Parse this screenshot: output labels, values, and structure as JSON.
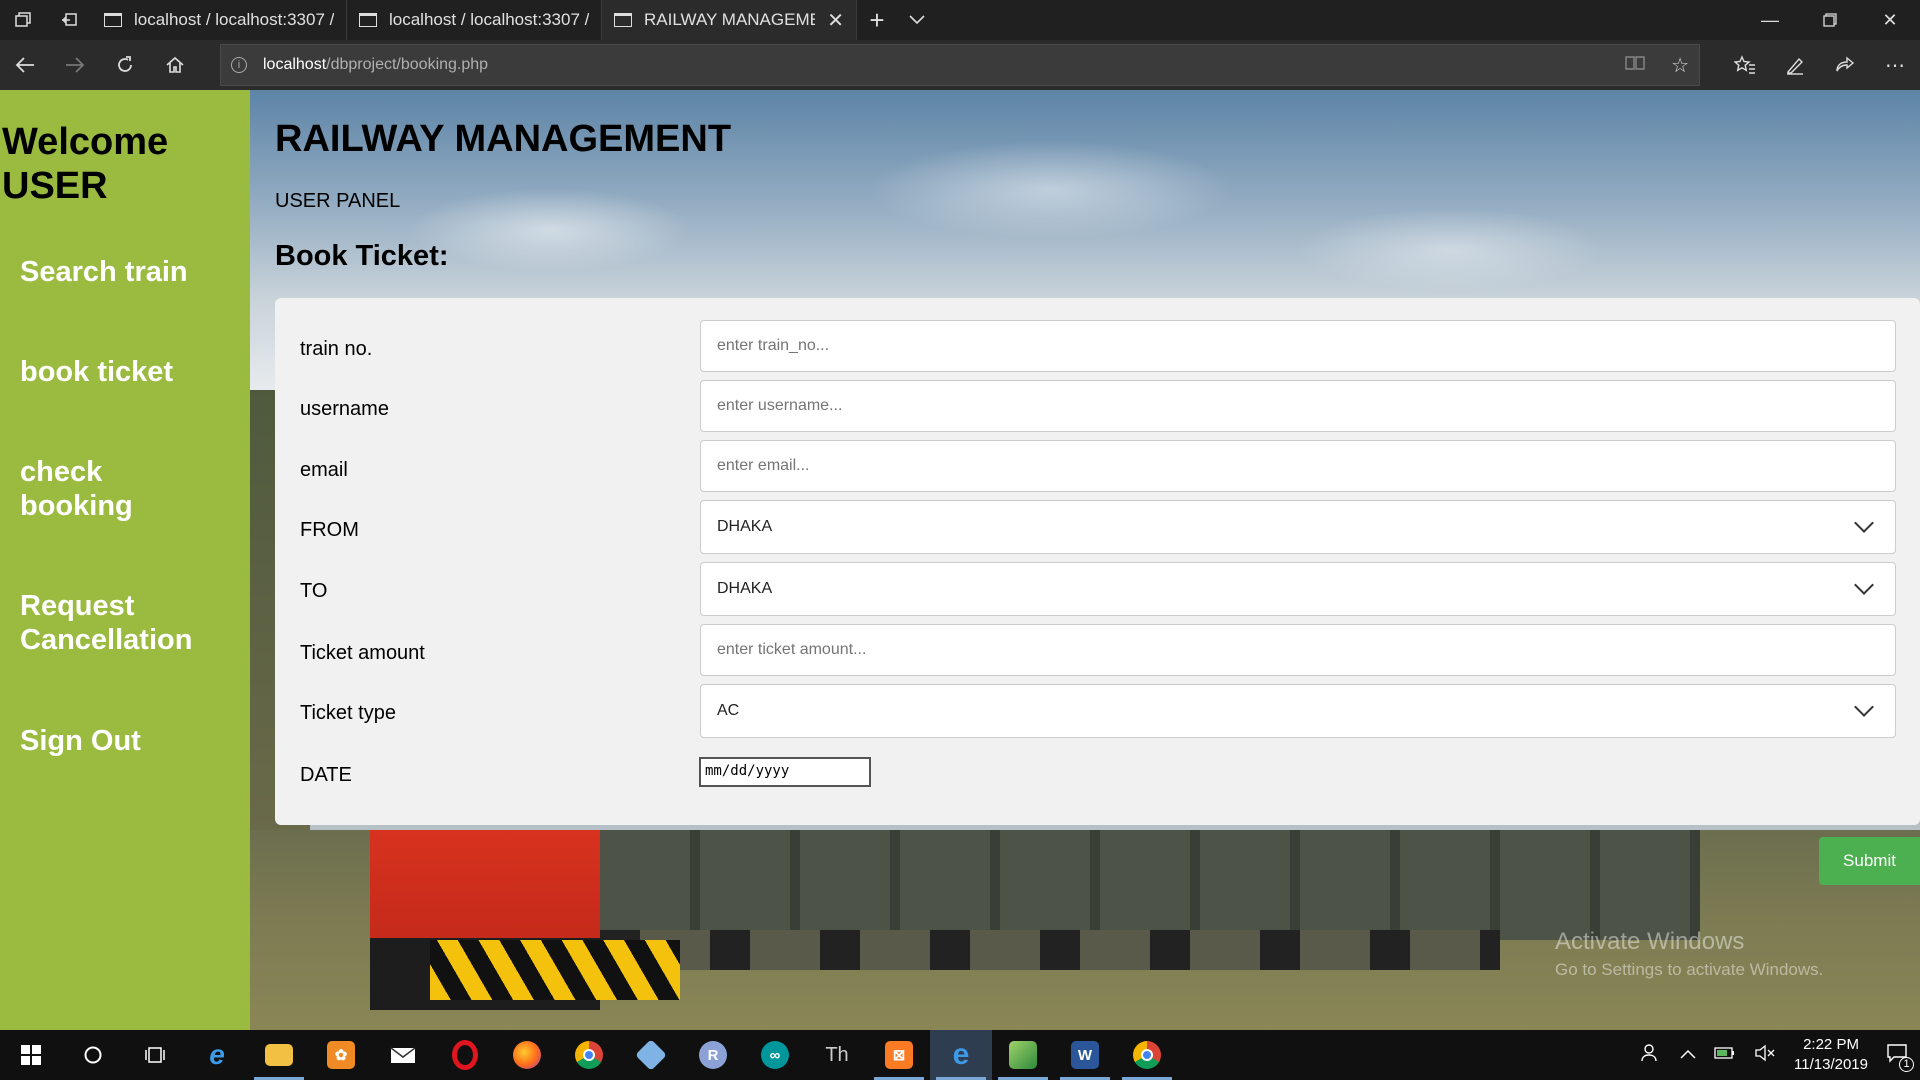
{
  "browser": {
    "tabs": [
      {
        "label": "localhost / localhost:3307 /",
        "active": false
      },
      {
        "label": "localhost / localhost:3307 /",
        "active": false
      },
      {
        "label": "RAILWAY MANAGEMEN",
        "active": true
      }
    ],
    "url_host": "localhost",
    "url_path": "/dbproject/booking.php"
  },
  "sidebar": {
    "welcome_line1": "Welcome",
    "welcome_line2": "USER",
    "items": [
      {
        "label": "Search train"
      },
      {
        "label": "book ticket"
      },
      {
        "label": "check booking"
      },
      {
        "label": "Request Cancellation"
      },
      {
        "label": "Sign Out"
      }
    ],
    "color": "#9abb40"
  },
  "header": {
    "title": "RAILWAY MANAGEMENT",
    "subtitle": "USER PANEL",
    "section_title": "Book Ticket:"
  },
  "form": {
    "train_no": {
      "label": "train no.",
      "placeholder": "enter train_no..."
    },
    "username": {
      "label": "username",
      "placeholder": "enter username..."
    },
    "email": {
      "label": "email",
      "placeholder": "enter email..."
    },
    "from": {
      "label": "FROM",
      "selected": "DHAKA"
    },
    "to": {
      "label": "TO",
      "selected": "DHAKA"
    },
    "ticket_amount": {
      "label": "Ticket amount",
      "placeholder": "enter ticket amount..."
    },
    "ticket_type": {
      "label": "Ticket type",
      "selected": "AC"
    },
    "date": {
      "label": "DATE",
      "placeholder": "mm/dd/yyyy"
    },
    "submit_label": "Submit",
    "submit_color": "#4caf50"
  },
  "watermark": {
    "line1": "Activate Windows",
    "line2": "Go to Settings to activate Windows."
  },
  "taskbar": {
    "time": "2:22 PM",
    "date": "11/13/2019",
    "notification_count": "1"
  }
}
